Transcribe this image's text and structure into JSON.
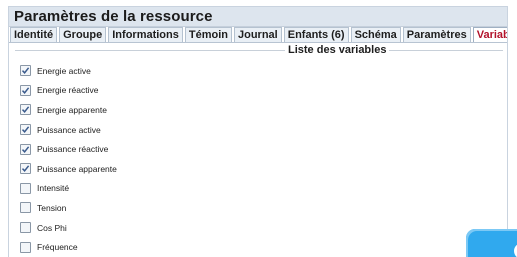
{
  "panel": {
    "title": "Paramètres de la ressource"
  },
  "tabs": [
    {
      "label": "Identité",
      "active": false
    },
    {
      "label": "Groupe",
      "active": false
    },
    {
      "label": "Informations",
      "active": false
    },
    {
      "label": "Témoin",
      "active": false
    },
    {
      "label": "Journal",
      "active": false
    },
    {
      "label": "Enfants (6)",
      "active": false
    },
    {
      "label": "Schéma",
      "active": false
    },
    {
      "label": "Paramètres",
      "active": false
    },
    {
      "label": "Variables",
      "active": true
    }
  ],
  "variables": {
    "legend": "Liste des variables",
    "items": [
      {
        "label": "Energie active",
        "checked": true
      },
      {
        "label": "Energie réactive",
        "checked": true
      },
      {
        "label": "Energie apparente",
        "checked": true
      },
      {
        "label": "Puissance active",
        "checked": true
      },
      {
        "label": "Puissance réactive",
        "checked": true
      },
      {
        "label": "Puissance apparente",
        "checked": true
      },
      {
        "label": "Intensité",
        "checked": false
      },
      {
        "label": "Tension",
        "checked": false
      },
      {
        "label": "Cos Phi",
        "checked": false
      },
      {
        "label": "Fréquence",
        "checked": false
      }
    ]
  },
  "colors": {
    "active_tab_text": "#b2122b",
    "corner_widget": "#30a9ee"
  }
}
